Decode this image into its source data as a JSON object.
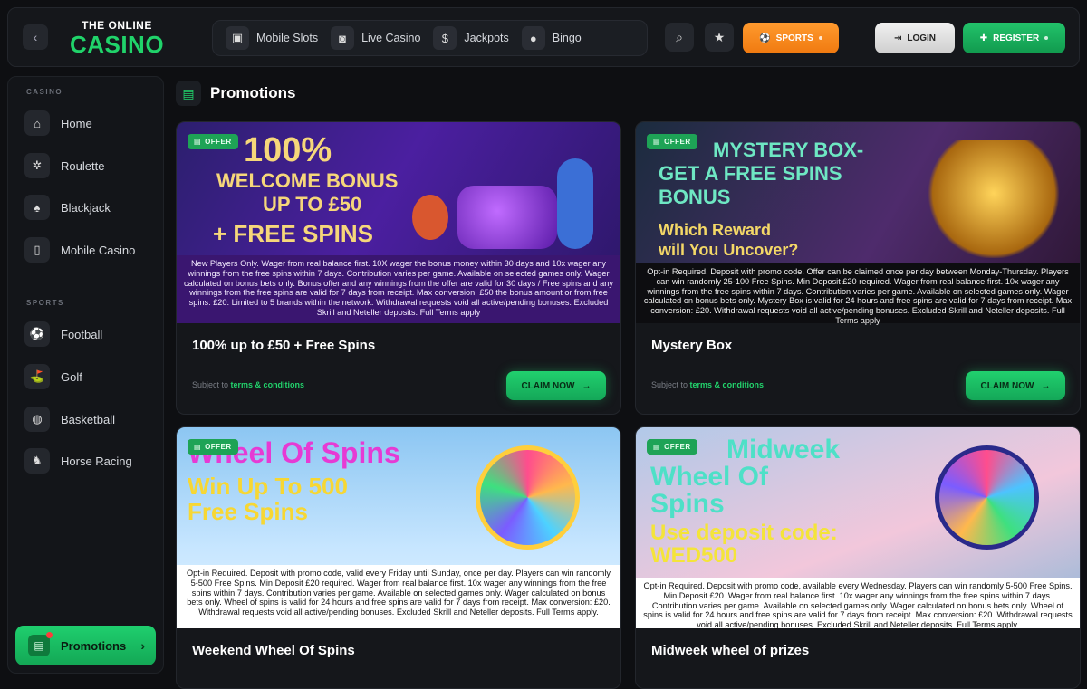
{
  "header": {
    "logo_top": "THE ONLINE",
    "logo_main": "CASINO",
    "nav": [
      {
        "label": "Mobile Slots",
        "icon": "phone-slots-icon"
      },
      {
        "label": "Live Casino",
        "icon": "camera-icon"
      },
      {
        "label": "Jackpots",
        "icon": "money-bag-icon"
      },
      {
        "label": "Bingo",
        "icon": "bingo-ball-icon"
      }
    ],
    "sports_label": "SPORTS",
    "login_label": "LOGIN",
    "register_label": "REGISTER"
  },
  "sidebar": {
    "casino_section": "CASINO",
    "casino_items": [
      {
        "label": "Home",
        "icon": "home-icon"
      },
      {
        "label": "Roulette",
        "icon": "roulette-icon"
      },
      {
        "label": "Blackjack",
        "icon": "cards-icon"
      },
      {
        "label": "Mobile Casino",
        "icon": "mobile-icon"
      }
    ],
    "sports_section": "SPORTS",
    "sports_items": [
      {
        "label": "Football",
        "icon": "football-icon"
      },
      {
        "label": "Golf",
        "icon": "golf-icon"
      },
      {
        "label": "Basketball",
        "icon": "basketball-icon"
      },
      {
        "label": "Horse Racing",
        "icon": "horse-icon"
      }
    ],
    "promotions_label": "Promotions"
  },
  "page": {
    "title": "Promotions"
  },
  "promos": [
    {
      "badge": "OFFER",
      "banner_lines": [
        "100%",
        "WELCOME BONUS",
        "UP TO £50",
        "+ FREE SPINS"
      ],
      "terms": "New Players Only. Wager from real balance first. 10X wager the bonus money within 30 days and 10x wager any winnings from the free spins within 7 days. Contribution varies per game. Available on selected games only. Wager calculated on bonus bets only. Bonus offer and any winnings from the offer are valid for 30 days / Free spins and any winnings from the free spins are valid for 7 days from receipt. Max conversion: £50 the bonus amount or from free spins: £20. Limited to 5 brands within the network. Withdrawal requests void all active/pending bonuses. Excluded Skrill and Neteller deposits. Full Terms apply",
      "title": "100% up to £50 + Free Spins",
      "subject_prefix": "Subject to",
      "subject_link": "terms & conditions",
      "claim": "CLAIM NOW"
    },
    {
      "badge": "OFFER",
      "banner_lines": [
        "MYSTERY BOX-",
        "GET A FREE SPINS",
        "BONUS",
        "Which Reward",
        "will You Uncover?"
      ],
      "terms": "Opt-in Required. Deposit with promo code. Offer can be claimed once per day between Monday-Thursday. Players can win randomly 25-100 Free Spins. Min Deposit £20 required. Wager from real balance first. 10x wager any winnings from the free spins within 7 days. Contribution varies per game. Available on selected games only. Wager calculated on bonus bets only. Mystery Box is valid for 24 hours and free spins are valid for 7 days from receipt. Max conversion: £20. Withdrawal requests void all active/pending bonuses. Excluded Skrill and Neteller deposits. Full Terms apply",
      "title": "Mystery Box",
      "subject_prefix": "Subject to",
      "subject_link": "terms & conditions",
      "claim": "CLAIM NOW"
    },
    {
      "badge": "OFFER",
      "banner_lines": [
        "Wheel Of Spins",
        "Win Up To 500",
        "Free Spins"
      ],
      "terms": "Opt-in Required. Deposit with promo code, valid every Friday until Sunday, once per day. Players can win randomly 5-500 Free Spins. Min Deposit £20 required. Wager from real balance first. 10x wager any winnings from the free spins within 7 days. Contribution varies per game. Available on selected games only. Wager calculated on bonus bets only. Wheel of spins is valid for 24 hours and free spins are valid for 7 days from receipt. Max conversion: £20. Withdrawal requests void all active/pending bonuses. Excluded Skrill and Neteller deposits. Full Terms apply.",
      "title": "Weekend Wheel Of Spins"
    },
    {
      "badge": "OFFER",
      "banner_lines": [
        "Midweek",
        "Wheel Of",
        "Spins",
        "Use deposit code:",
        "WED500"
      ],
      "terms": "Opt-in Required. Deposit with promo code, available every Wednesday. Players can win randomly 5-500 Free Spins. Min Deposit £20. Wager from real balance first. 10x wager any winnings from the free spins within 7 days. Contribution varies per game. Available on selected games only. Wager calculated on bonus bets only. Wheel of spins is valid for 24 hours and free spins are valid for 7 days from receipt. Max conversion: £20. Withdrawal requests void all active/pending bonuses. Excluded Skrill and Neteller deposits. Full Terms apply.",
      "title": "Midweek wheel of prizes"
    }
  ]
}
